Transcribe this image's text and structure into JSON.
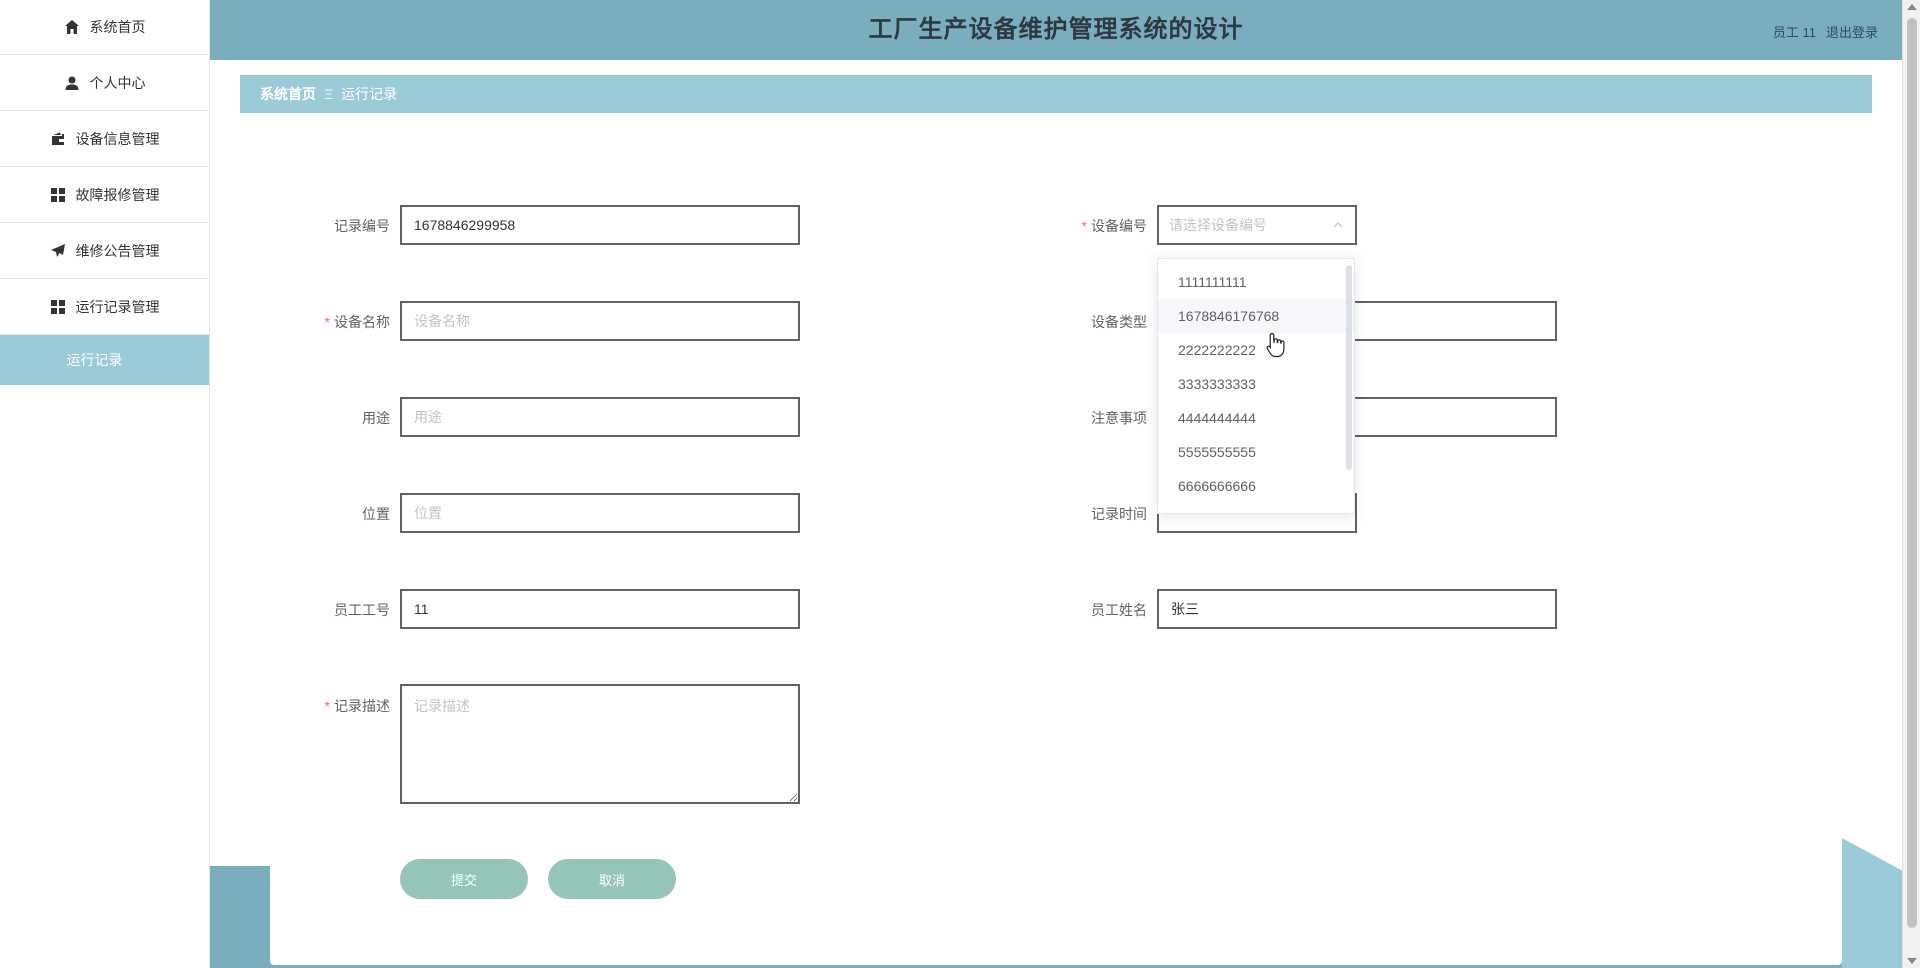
{
  "app": {
    "title": "工厂生产设备维护管理系统的设计",
    "user_label": "员工 11",
    "logout_label": "退出登录"
  },
  "sidebar": {
    "items": [
      {
        "label": "系统首页",
        "icon": "home-icon"
      },
      {
        "label": "个人中心",
        "icon": "user-icon"
      },
      {
        "label": "设备信息管理",
        "icon": "wallet-icon"
      },
      {
        "label": "故障报修管理",
        "icon": "grid-icon"
      },
      {
        "label": "维修公告管理",
        "icon": "send-icon"
      },
      {
        "label": "运行记录管理",
        "icon": "grid-icon"
      }
    ],
    "active_sub": "运行记录"
  },
  "breadcrumb": {
    "home": "系统首页",
    "separator": "Ξ",
    "current": "运行记录"
  },
  "form": {
    "record_no": {
      "label": "记录编号",
      "value": "1678846299958"
    },
    "device_no": {
      "label": "设备编号",
      "placeholder": "请选择设备编号"
    },
    "device_name": {
      "label": "设备名称",
      "placeholder": "设备名称"
    },
    "device_type": {
      "label": "设备类型",
      "placeholder": ""
    },
    "usage": {
      "label": "用途",
      "placeholder": "用途"
    },
    "notice": {
      "label": "注意事项",
      "placeholder": ""
    },
    "location": {
      "label": "位置",
      "placeholder": "位置"
    },
    "record_time": {
      "label": "记录时间",
      "value": ""
    },
    "staff_no": {
      "label": "员工工号",
      "value": "11"
    },
    "staff_name": {
      "label": "员工姓名",
      "value": "张三"
    },
    "description": {
      "label": "记录描述",
      "placeholder": "记录描述"
    },
    "required_mark": "*",
    "submit_label": "提交",
    "cancel_label": "取消"
  },
  "dropdown": {
    "options": [
      "1111111111",
      "1678846176768",
      "2222222222",
      "3333333333",
      "4444444444",
      "5555555555",
      "6666666666"
    ],
    "hovered_index": 1
  },
  "colors": {
    "header_bg": "#7aaebf",
    "breadcrumb_bg": "#9ccbd8",
    "button_bg": "#94c5b8",
    "required": "#f56c6c"
  }
}
